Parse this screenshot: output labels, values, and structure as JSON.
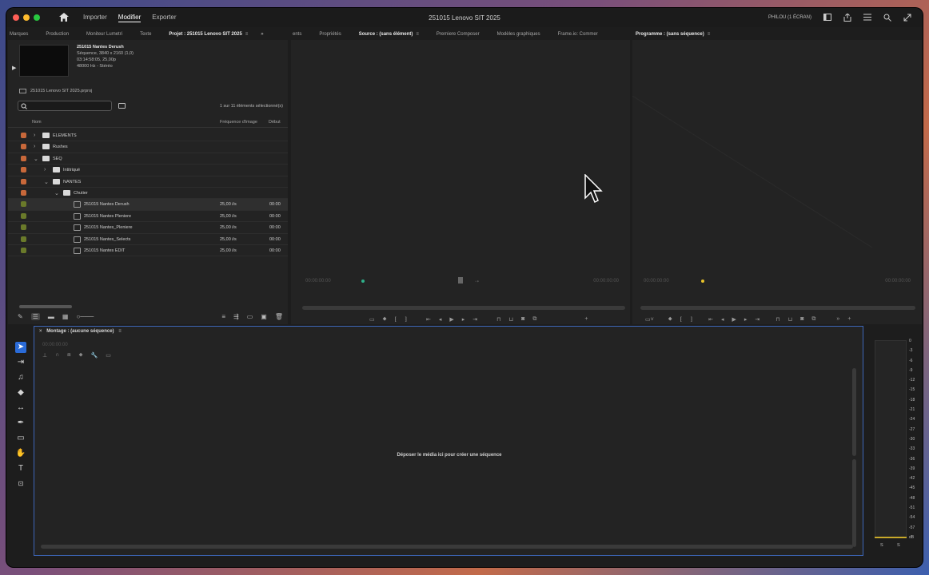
{
  "window": {
    "title": "251015 Lenovo SIT 2025",
    "nav": [
      "Importer",
      "Modifier",
      "Exporter"
    ],
    "active_nav": "Modifier",
    "screen_label": "PHILOU (1 ÉCRAN)"
  },
  "left_tabs": [
    "Marques",
    "Production",
    "Moniteur Lumetri",
    "Texte",
    "Projet : 251015 Lenovo SIT 2025"
  ],
  "middle_tabs": [
    "ents",
    "Propriétés",
    "Source : (sans élément)",
    "Premiere Composer",
    "Modèles graphiques",
    "Frame.io: Commer"
  ],
  "program_tab": "Programme : (sans séquence)",
  "project": {
    "selected_item": {
      "name": "251015 Nantes Derush",
      "line1": "Séquence, 3840 x 2160 (1,0)",
      "line2": "03:14:58:05, 25,00p",
      "line3": "48000 Hz - Stéréo"
    },
    "file": "251015 Lenovo SIT 2025.prproj",
    "selection_count": "1 sur 11 éléments sélectionné(s)",
    "columns": {
      "name": "Nom",
      "fps": "Fréquence d'image",
      "start": "Début"
    },
    "rows": [
      {
        "name": "ELEMENTS",
        "type": "folder",
        "indent": 0,
        "expanded": false,
        "color": "#c8683a"
      },
      {
        "name": "Rushes",
        "type": "folder",
        "indent": 0,
        "expanded": false,
        "color": "#c8683a"
      },
      {
        "name": "SEQ",
        "type": "folder",
        "indent": 0,
        "expanded": true,
        "color": "#c8683a"
      },
      {
        "name": "Intitriqué",
        "type": "folder",
        "indent": 1,
        "expanded": false,
        "color": "#c8683a"
      },
      {
        "name": "NANTES",
        "type": "folder",
        "indent": 1,
        "expanded": true,
        "color": "#c8683a"
      },
      {
        "name": "Chutier",
        "type": "folder",
        "indent": 2,
        "expanded": true,
        "color": "#c8683a"
      },
      {
        "name": "251015 Nantes Derush",
        "type": "seq",
        "indent": 3,
        "fps": "25,00 i/s",
        "start": "00:00",
        "color": "#6a7a2a"
      },
      {
        "name": "251015 Nantes Pleniere",
        "type": "seq",
        "indent": 3,
        "fps": "25,00 i/s",
        "start": "00:00",
        "color": "#6a7a2a"
      },
      {
        "name": "251015 Nantes_Pleniere",
        "type": "seq",
        "indent": 3,
        "fps": "25,00 i/s",
        "start": "00:00",
        "color": "#6a7a2a"
      },
      {
        "name": "251015 Nantes_Selects",
        "type": "seq",
        "indent": 3,
        "fps": "25,00 i/s",
        "start": "00:00",
        "color": "#6a7a2a"
      },
      {
        "name": "251015 Nantes EDIT",
        "type": "seq",
        "indent": 3,
        "fps": "25,00 i/s",
        "start": "00:00",
        "color": "#6a7a2a"
      }
    ]
  },
  "source": {
    "tc_left": "00:00:00:00",
    "tc_right": "00:00:00:00"
  },
  "program": {
    "tc_left": "00:00:00:00",
    "tc_right": "00:00:00:00"
  },
  "timeline": {
    "tab": "Montage : (aucune séquence)",
    "timecode": "00:00:00:00",
    "drop_message": "Déposer le média ici pour créer une séquence"
  },
  "meter": {
    "scale": [
      "0",
      "-3",
      "-6",
      "-9",
      "-12",
      "-15",
      "-18",
      "-21",
      "-24",
      "-27",
      "-30",
      "-33",
      "-36",
      "-39",
      "-42",
      "-45",
      "-48",
      "-51",
      "-54",
      "-57",
      "dB"
    ],
    "channels": [
      "S",
      "S"
    ]
  },
  "colors": {
    "accent": "#2a6bd8",
    "folder_label": "#c8683a",
    "sequence_label": "#6a7a2a",
    "timeline_border": "#3d66b8"
  }
}
